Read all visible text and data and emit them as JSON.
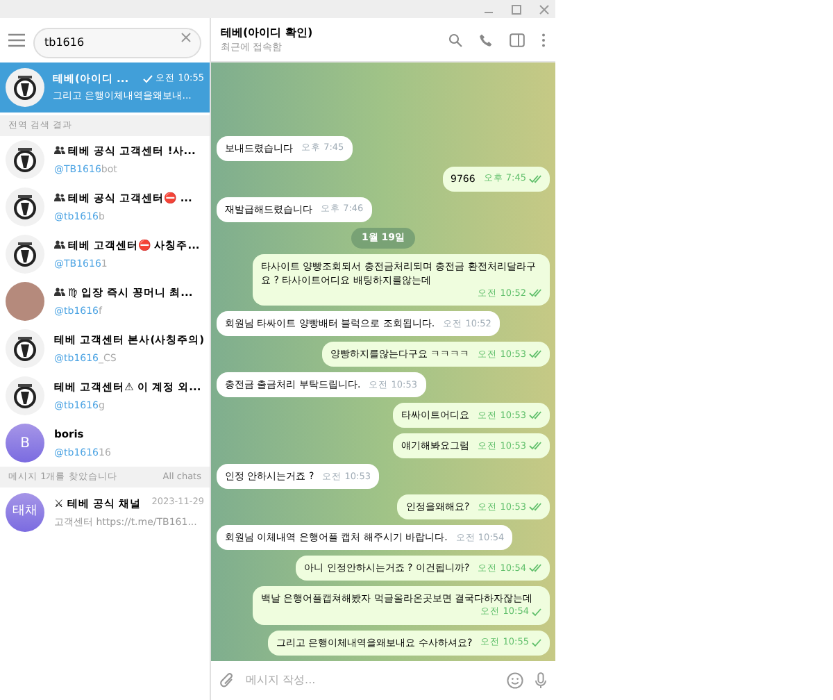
{
  "search": {
    "value": "tb1616"
  },
  "selected_chat": {
    "name": "테베(아이디 ...",
    "time": "오전 10:55",
    "preview": "그리고 은행이체내역을왜보내...",
    "read": true,
    "selected": true
  },
  "global_results_header": "전역 검색 결과",
  "results": [
    {
      "group": true,
      "kind": "logo",
      "name": "테베 공식 고객센터 !사...",
      "match": "@TB1616",
      "rest": "bot"
    },
    {
      "group": true,
      "kind": "logo",
      "name": "테베 공식 고객센터⛔ ...",
      "match": "@tb1616",
      "rest": "b"
    },
    {
      "group": true,
      "kind": "logo",
      "name": "테베 고객센터⛔ 사칭주...",
      "match": "@TB1616",
      "rest": "1"
    },
    {
      "group": true,
      "kind": "photo",
      "name": "♍ 입장 즉시 꽁머니 최...",
      "match": "@tb1616",
      "rest": "f"
    },
    {
      "group": false,
      "kind": "logo",
      "name": "테베 고객센터 본사(사칭주의)",
      "match": "@tb1616",
      "rest": "_CS"
    },
    {
      "group": false,
      "kind": "logo",
      "name": "테베 고객센터⚠ 이 계정 외...",
      "match": "@tb1616",
      "rest": "g"
    },
    {
      "group": false,
      "kind": "letter",
      "letter": "B",
      "name": "boris",
      "match": "@tb1616",
      "rest": "16"
    }
  ],
  "messages_header": {
    "label": "메시지 1개를 찾았습니다",
    "filter": "All chats"
  },
  "message_results": [
    {
      "avatar_text": "태채",
      "name": "⚔ 테베 공식 채널",
      "date": "2023-11-29",
      "preview": "고객센터 https://t.me/TB161..."
    }
  ],
  "chat": {
    "title": "테베(아이디 확인)",
    "status": "최근에 접속함"
  },
  "messages": [
    {
      "kind": "message",
      "out": false,
      "text": "보내드렸습니다",
      "time": "오후 7:45"
    },
    {
      "kind": "message",
      "out": true,
      "text": "9766",
      "time": "오후 7:45",
      "read": true
    },
    {
      "kind": "message",
      "out": false,
      "text": "재발급해드렸습니다",
      "time": "오후 7:46"
    },
    {
      "kind": "date",
      "text": "1월 19일"
    },
    {
      "kind": "message",
      "out": true,
      "text": "타사이트 양빵조회되서 충전금처리되며 충전금 환전처리달라구요 ? 타사이트어디요 배팅하지를않는데",
      "time": "오전 10:52",
      "read": true
    },
    {
      "kind": "message",
      "out": false,
      "text": "회원님 타싸이트 양빵배터 블럭으로 조회됩니다.",
      "time": "오전 10:52"
    },
    {
      "kind": "message",
      "out": true,
      "text": "양빵하지를않는다구요 ㅋㅋㅋㅋ",
      "time": "오전 10:53",
      "read": true
    },
    {
      "kind": "message",
      "out": false,
      "text": "충전금 출금처리 부탁드립니다.",
      "time": "오전 10:53"
    },
    {
      "kind": "message",
      "out": true,
      "text": "타싸이트어디요",
      "time": "오전 10:53",
      "read": true
    },
    {
      "kind": "message",
      "out": true,
      "text": "얘기해봐요그럼",
      "time": "오전 10:53",
      "read": true
    },
    {
      "kind": "message",
      "out": false,
      "text": "인정 안하시는거죠 ?",
      "time": "오전 10:53"
    },
    {
      "kind": "message",
      "out": true,
      "text": "인정을왜해요?",
      "time": "오전 10:53",
      "read": true
    },
    {
      "kind": "message",
      "out": false,
      "text": "회원님 이체내역 은행어플 캡처 해주시기 바랍니다.",
      "time": "오전 10:54"
    },
    {
      "kind": "message",
      "out": true,
      "text": "아니 인정안하시는거죠 ? 이건됩니까?",
      "time": "오전 10:54",
      "read": true
    },
    {
      "kind": "message",
      "out": true,
      "text": "백날 은행어플캡쳐해봤자 먹글올라온곳보면 결국다하자잖는데",
      "time": "오전 10:54",
      "read": false
    },
    {
      "kind": "message",
      "out": true,
      "text": "그리고 은행이체내역을왜보내요 수사하셔요?",
      "time": "오전 10:55",
      "read": false
    }
  ],
  "composer": {
    "placeholder": "메시지 작성..."
  }
}
